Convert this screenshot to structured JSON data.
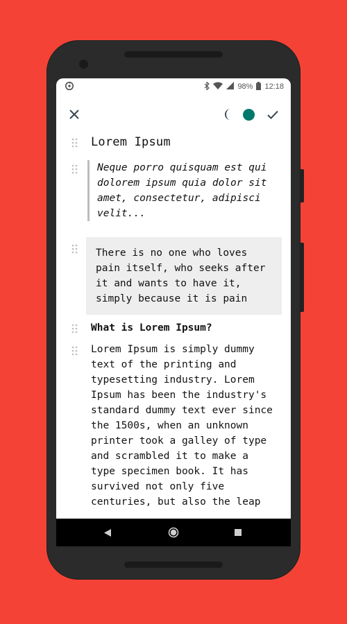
{
  "status_bar": {
    "left_icon": "sync-icon",
    "icons": [
      "bluetooth-icon",
      "wifi-icon",
      "signal-icon"
    ],
    "battery_level": "98%",
    "time": "12:18"
  },
  "toolbar": {
    "close_icon": "close-icon",
    "theme_icon": "moon-icon",
    "color_swatch": "#00796B",
    "confirm_icon": "check-icon"
  },
  "document": {
    "title": "Lorem Ipsum",
    "quote_lines": [
      "Neque porro quisquam est qui",
      "dolorem ipsum quia dolor sit",
      "amet, consectetur, adipisci",
      "velit..."
    ],
    "code_lines": [
      "There is no one who loves",
      "pain itself, who seeks after",
      "it and wants to have it,",
      "simply because it is pain"
    ],
    "subheading": "What is Lorem Ipsum?",
    "paragraph_lines": [
      "Lorem Ipsum is simply dummy",
      "text of the printing and",
      "typesetting industry. Lorem",
      "Ipsum has been the industry's",
      "standard dummy text ever since",
      "the 1500s, when an unknown",
      "printer took a galley of type",
      "and scrambled it to make a",
      "type specimen book. It has",
      "survived not only five",
      "centuries, but also the leap"
    ]
  },
  "format_bar": {
    "buttons": [
      "heading-large-icon",
      "heading-small-icon",
      "quote-icon",
      "code-icon",
      "checklist-icon",
      "paragraph-icon"
    ]
  },
  "nav_bar": {
    "buttons": [
      "back-icon",
      "home-icon",
      "recents-icon"
    ]
  },
  "colors": {
    "background": "#F44336",
    "accent": "#00796B",
    "icon": "#37474F"
  }
}
